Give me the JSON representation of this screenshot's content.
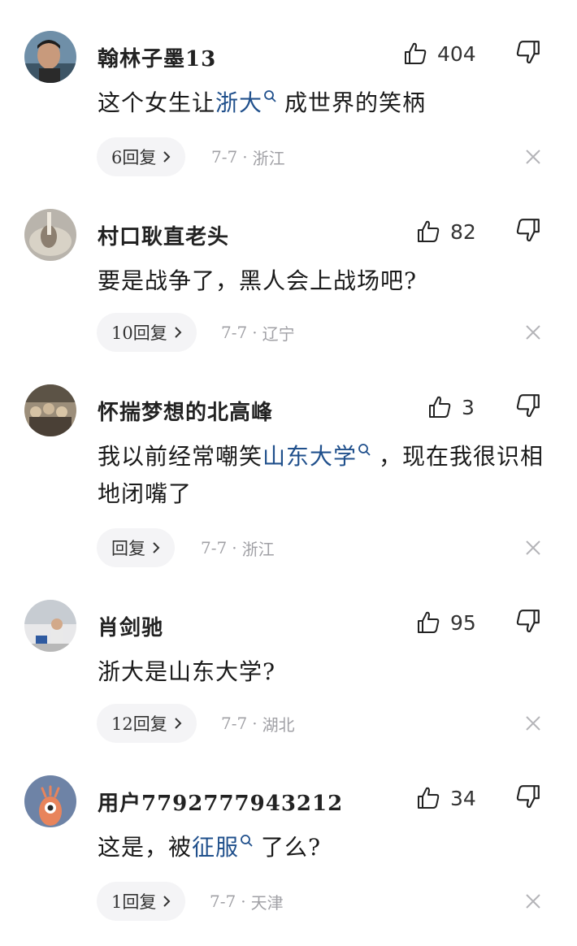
{
  "comments": [
    {
      "username": "翰林子墨13",
      "likes": "404",
      "text_before": "这个女生让",
      "keyword": "浙大",
      "text_after": "成世界的笑柄",
      "replies": "6回复",
      "date": "7-7",
      "location": "浙江"
    },
    {
      "username": "村口耿直老头",
      "likes": "82",
      "text": "要是战争了，黑人会上战场吧?",
      "replies": "10回复",
      "date": "7-7",
      "location": "辽宁"
    },
    {
      "username": "怀揣梦想的北高峰",
      "likes": "3",
      "text_before": "我以前经常嘲笑",
      "keyword": "山东大学",
      "text_after": "，现在我很识相地闭嘴了",
      "replies": "回复",
      "date": "7-7",
      "location": "浙江"
    },
    {
      "username": "肖剑驰",
      "likes": "95",
      "text": "浙大是山东大学?",
      "replies": "12回复",
      "date": "7-7",
      "location": "湖北"
    },
    {
      "username": "用户7792777943212",
      "likes": "34",
      "text_before": "这是，被",
      "keyword": "征服",
      "text_after": "了么?",
      "replies": "1回复",
      "date": "7-7",
      "location": "天津"
    }
  ],
  "meta_separator": "·",
  "colors": {
    "keyword": "#20508c",
    "meta": "#a0a0a5",
    "reply_bg": "#f4f4f6"
  },
  "icons": [
    "like-icon",
    "dislike-icon",
    "search-icon",
    "chevron-right-icon",
    "close-icon"
  ]
}
